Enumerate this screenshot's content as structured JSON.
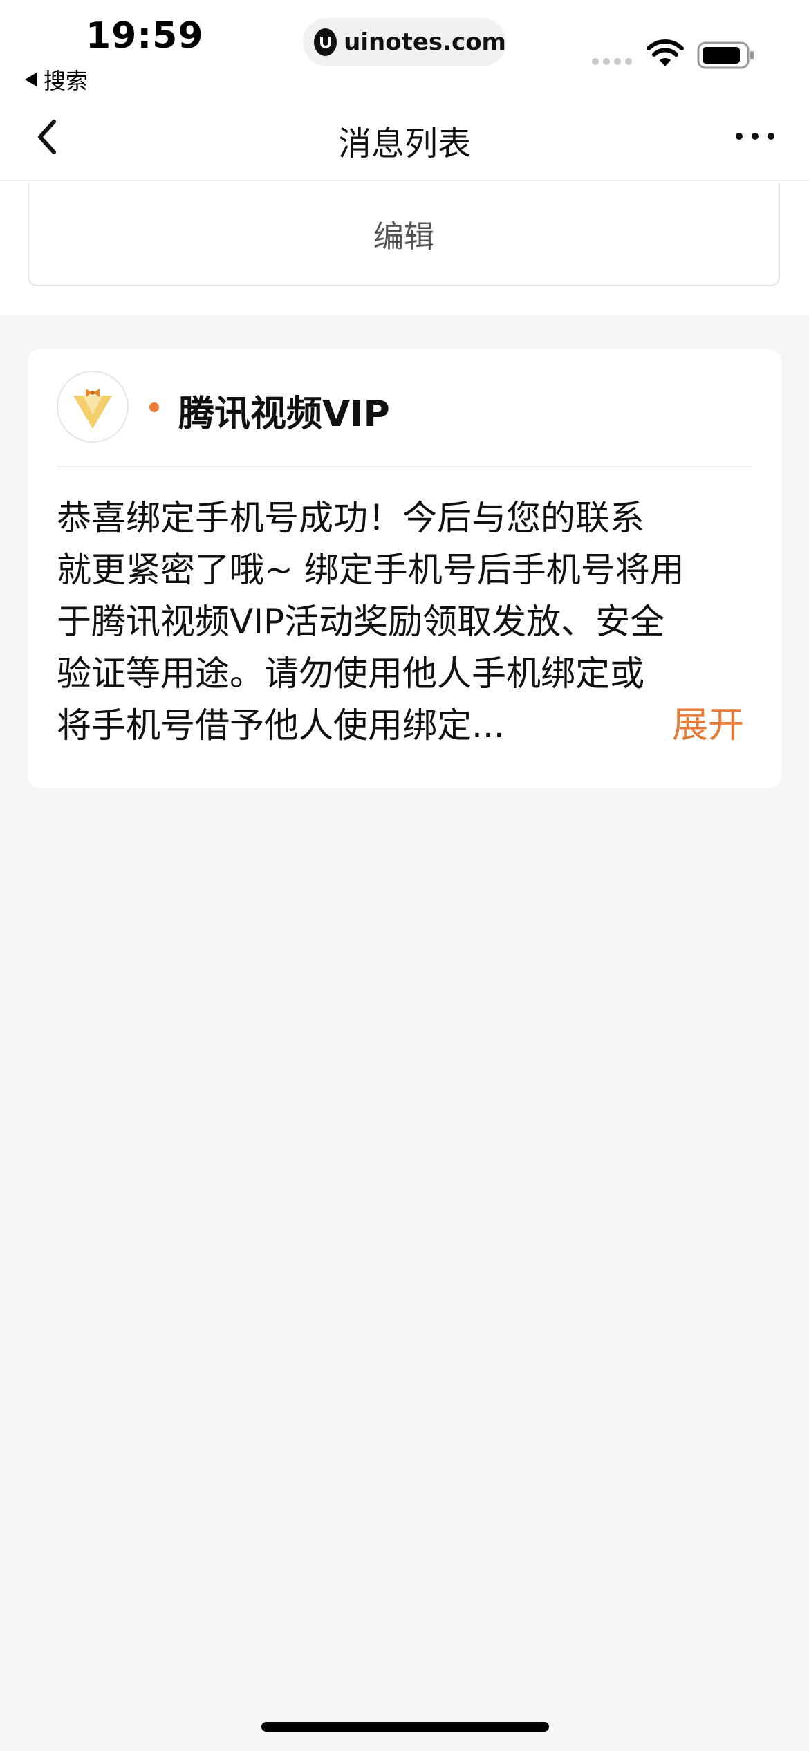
{
  "status_bar": {
    "time": "19:59",
    "back_app_label": "搜索",
    "url": "uinotes.com"
  },
  "nav": {
    "title": "消息列表"
  },
  "edit_button": {
    "label": "编辑"
  },
  "message": {
    "sender": "腾讯视频VIP",
    "body_lines": [
      "恭喜绑定手机号成功！今后与您的联系",
      "就更紧密了哦~ 绑定手机号后手机号将用",
      "于腾讯视频VIP活动奖励领取发放、安全",
      "验证等用途。请勿使用他人手机绑定或",
      "将手机号借予他人使用绑定..."
    ],
    "expand_label": "展开"
  },
  "colors": {
    "accent": "#e87a35",
    "page_bg": "#f4f5f7",
    "card_bg": "#ffffff"
  },
  "icons": {
    "back": "chevron-left-icon",
    "more": "more-dots-icon",
    "avatar": "tencent-vip-logo",
    "wifi": "wifi-icon",
    "battery": "battery-icon"
  }
}
